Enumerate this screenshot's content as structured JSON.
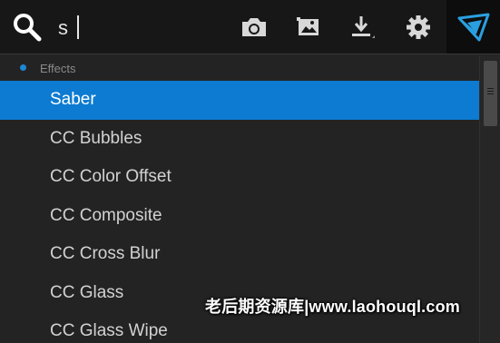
{
  "search": {
    "value": "s",
    "placeholder": ""
  },
  "toolbar": {
    "buttons": [
      {
        "icon": "camera-icon"
      },
      {
        "icon": "image-icon"
      },
      {
        "icon": "download-icon"
      },
      {
        "icon": "gear-icon"
      }
    ],
    "brand_icon": "plugin-logo-icon"
  },
  "results": {
    "category": "Effects",
    "items": [
      {
        "label": "Saber",
        "selected": true
      },
      {
        "label": "CC Bubbles",
        "selected": false
      },
      {
        "label": "CC Color Offset",
        "selected": false
      },
      {
        "label": "CC Composite",
        "selected": false
      },
      {
        "label": "CC Cross Blur",
        "selected": false
      },
      {
        "label": "CC Glass",
        "selected": false
      },
      {
        "label": "CC Glass Wipe",
        "selected": false
      }
    ]
  },
  "watermark": {
    "text": "老后期资源库|www.laohouql.com"
  },
  "colors": {
    "accent": "#0c7bd1",
    "topbar_bg": "#171717",
    "list_bg": "#232323",
    "brand_blue": "#2a9fe0"
  }
}
